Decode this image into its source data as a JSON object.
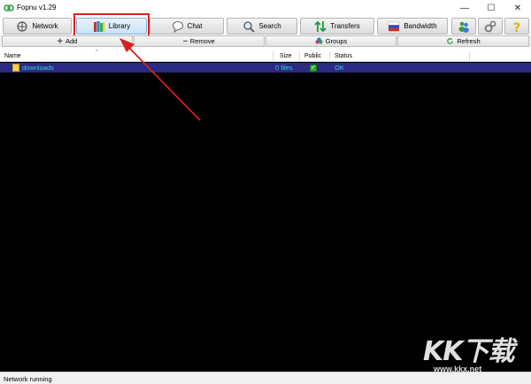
{
  "window": {
    "title": "Fopnu v1.29",
    "controls": {
      "minimize": "—",
      "maximize": "☐",
      "close": "✕"
    }
  },
  "toolbar": {
    "network": "Network",
    "library": "Library",
    "chat": "Chat",
    "search": "Search",
    "transfers": "Transfers",
    "bandwidth": "Bandwidth"
  },
  "subbar": {
    "add": "Add",
    "remove": "Remove",
    "groups": "Groups",
    "refresh": "Refresh"
  },
  "list": {
    "columns": {
      "name": "Name",
      "size": "Size",
      "public": "Public",
      "status": "Status"
    },
    "rows": [
      {
        "name": "downloads",
        "size": "0 files",
        "public": true,
        "status": "OK"
      }
    ]
  },
  "statusbar": {
    "text": "Network running"
  },
  "watermark": {
    "logo": "KK下载",
    "url": "www.kkx.net"
  },
  "colors": {
    "highlight_box": "#e0201c",
    "arrow": "#d42020",
    "list_background": "#000000",
    "selected_row": "#2a2a80",
    "row_text": "#3fd0d8"
  }
}
